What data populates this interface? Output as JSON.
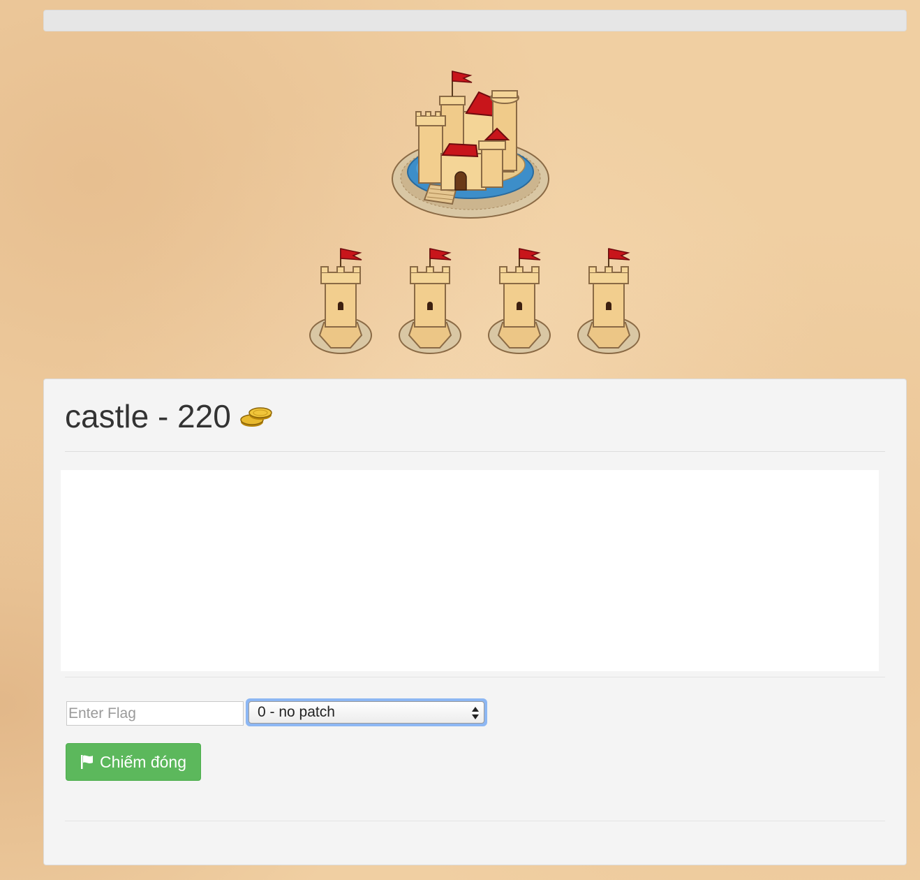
{
  "building": {
    "name": "castle - 220",
    "currency_icon": "gold-coins-icon",
    "main_image": "castle-image",
    "tower_count": 4,
    "tower_image": "tower-image"
  },
  "form": {
    "flag_placeholder": "Enter Flag",
    "flag_value": "",
    "patch_selected": "0 - no patch",
    "submit_label": "Chiếm đóng",
    "submit_icon": "flag-icon"
  },
  "colors": {
    "background": "#f0cfa2",
    "panel": "#f4f4f4",
    "button_green": "#5cb85c",
    "flag_red": "#c8151b",
    "focus_blue": "#8db7f3"
  }
}
